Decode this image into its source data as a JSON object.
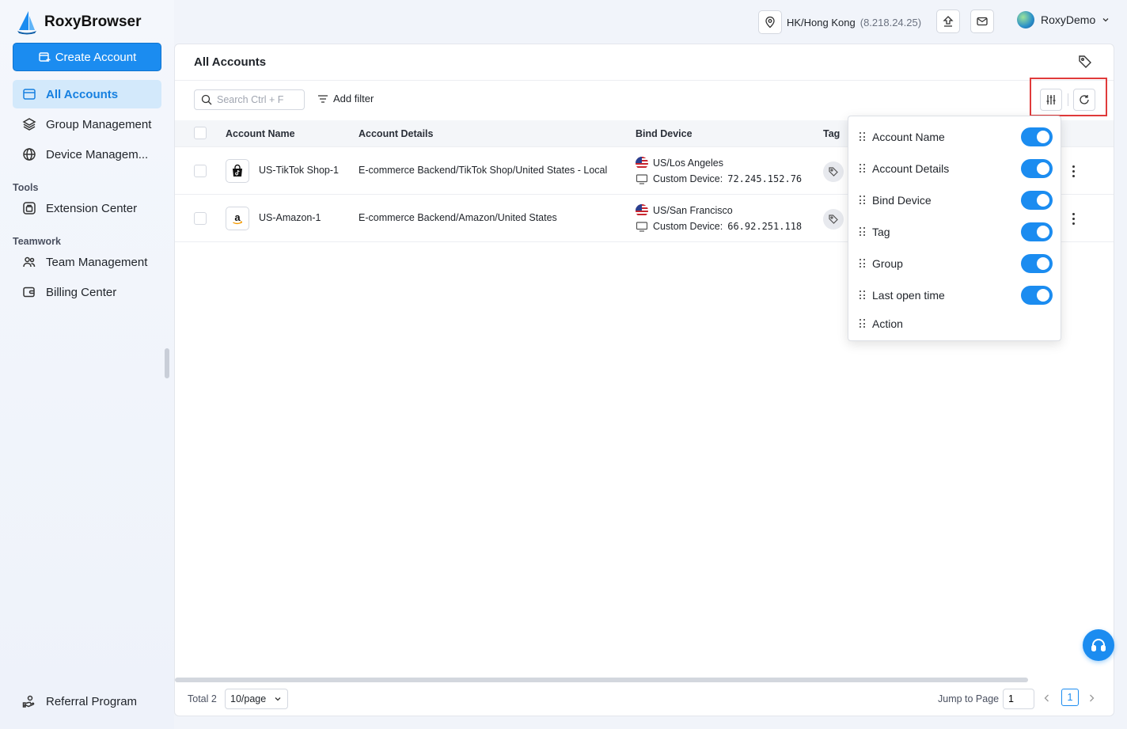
{
  "app": {
    "name": "RoxyBrowser"
  },
  "sidebar": {
    "create_label": "Create Account",
    "items": [
      {
        "label": "All Accounts",
        "icon": "list-icon",
        "active": true
      },
      {
        "label": "Group Management",
        "icon": "layers-icon"
      },
      {
        "label": "Device Managem...",
        "icon": "globe-icon"
      }
    ],
    "tools_label": "Tools",
    "tools_items": [
      {
        "label": "Extension Center",
        "icon": "extension-icon"
      }
    ],
    "teamwork_label": "Teamwork",
    "teamwork_items": [
      {
        "label": "Team Management",
        "icon": "team-icon"
      },
      {
        "label": "Billing Center",
        "icon": "wallet-icon"
      }
    ],
    "bottom_item": {
      "label": "Referral Program",
      "icon": "referral-icon"
    }
  },
  "topbar": {
    "location": "HK/Hong Kong",
    "ip": "(8.218.24.25)",
    "user": "RoxyDemo"
  },
  "main": {
    "title": "All Accounts",
    "search_placeholder": "Search Ctrl + F",
    "add_filter": "Add filter",
    "columns": [
      "Account Name",
      "Account Details",
      "Bind Device",
      "Tag"
    ],
    "rows": [
      {
        "name": "US-TikTok Shop-1",
        "platform_icon": "tiktok-shop-icon",
        "details": "E-commerce Backend/TikTok Shop/United States - Local",
        "device_location": "US/Los Angeles",
        "device_label": "Custom Device:",
        "device_ip": "72.245.152.76"
      },
      {
        "name": "US-Amazon-1",
        "platform_icon": "amazon-icon",
        "details": "E-commerce Backend/Amazon/United States",
        "device_location": "US/San Francisco",
        "device_label": "Custom Device:",
        "device_ip": "66.92.251.118"
      }
    ]
  },
  "column_popup": {
    "items": [
      {
        "label": "Account Name",
        "enabled": true
      },
      {
        "label": "Account Details",
        "enabled": true
      },
      {
        "label": "Bind Device",
        "enabled": true
      },
      {
        "label": "Tag",
        "enabled": true
      },
      {
        "label": "Group",
        "enabled": true
      },
      {
        "label": "Last open time",
        "enabled": true
      },
      {
        "label": "Action"
      }
    ]
  },
  "footer": {
    "total": "Total 2",
    "page_size": "10/page",
    "jump_label": "Jump to Page",
    "jump_value": "1",
    "current_page": "1"
  },
  "colors": {
    "accent": "#1b8cf0",
    "active_bg": "#d3e9fb",
    "highlight_frame": "#e03a3a"
  }
}
